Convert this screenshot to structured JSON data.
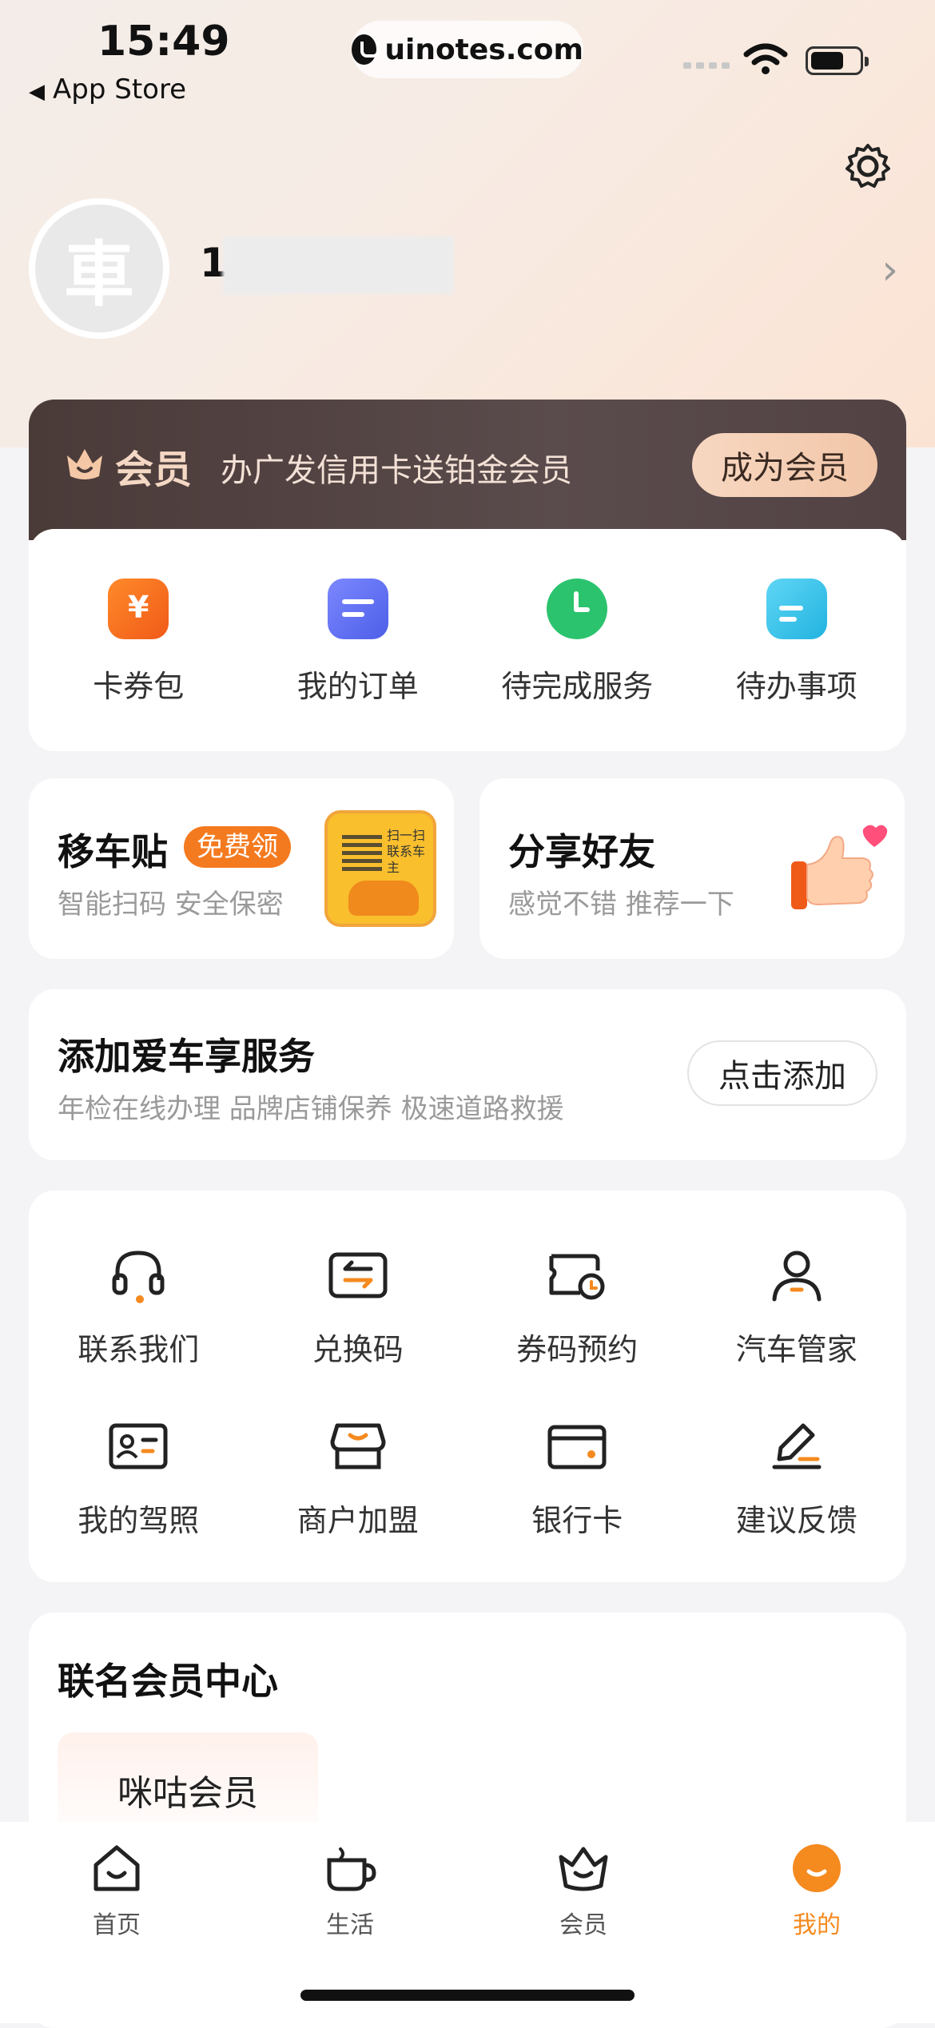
{
  "status_bar": {
    "time": "15:49",
    "back_app": "App Store",
    "url": "uinotes.com"
  },
  "profile": {
    "avatar_glyph": "車",
    "username_visible": "1"
  },
  "member": {
    "title": "会员",
    "promo": "办广发信用卡送铂金会员",
    "button": "成为会员"
  },
  "quick_actions": [
    {
      "label": "卡券包",
      "icon": "coupon-wallet-icon",
      "color": "#f56a1c"
    },
    {
      "label": "我的订单",
      "icon": "order-icon",
      "color": "#5a6cf0"
    },
    {
      "label": "待完成服务",
      "icon": "alarm-clock-icon",
      "color": "#27c06b"
    },
    {
      "label": "待办事项",
      "icon": "todo-doc-icon",
      "color": "#2bb8e6"
    }
  ],
  "move_car": {
    "title": "移车贴",
    "tag": "免费领",
    "subtitle": "智能扫码 安全保密",
    "sticker_text": "扫一扫 联系车主"
  },
  "share": {
    "title": "分享好友",
    "subtitle": "感觉不错 推荐一下"
  },
  "add_car": {
    "title": "添加爱车享服务",
    "subtitle": "年检在线办理 品牌店铺保养 极速道路救援",
    "button": "点击添加"
  },
  "tools": [
    {
      "label": "联系我们",
      "icon": "headset-icon"
    },
    {
      "label": "兑换码",
      "icon": "exchange-code-icon"
    },
    {
      "label": "券码预约",
      "icon": "ticket-clock-icon"
    },
    {
      "label": "汽车管家",
      "icon": "person-icon"
    },
    {
      "label": "我的驾照",
      "icon": "id-card-icon"
    },
    {
      "label": "商户加盟",
      "icon": "storefront-icon"
    },
    {
      "label": "银行卡",
      "icon": "bank-card-icon"
    },
    {
      "label": "建议反馈",
      "icon": "pen-edit-icon"
    }
  ],
  "co_branded": {
    "title": "联名会员中心",
    "items": [
      "咪咕会员"
    ]
  },
  "tabbar": [
    {
      "label": "首页",
      "icon": "home-icon"
    },
    {
      "label": "生活",
      "icon": "cup-icon"
    },
    {
      "label": "会员",
      "icon": "crown-icon"
    },
    {
      "label": "我的",
      "icon": "me-smile-icon",
      "active": true
    }
  ],
  "colors": {
    "accent": "#f58a1f",
    "member_bg": "#4a3a38"
  }
}
